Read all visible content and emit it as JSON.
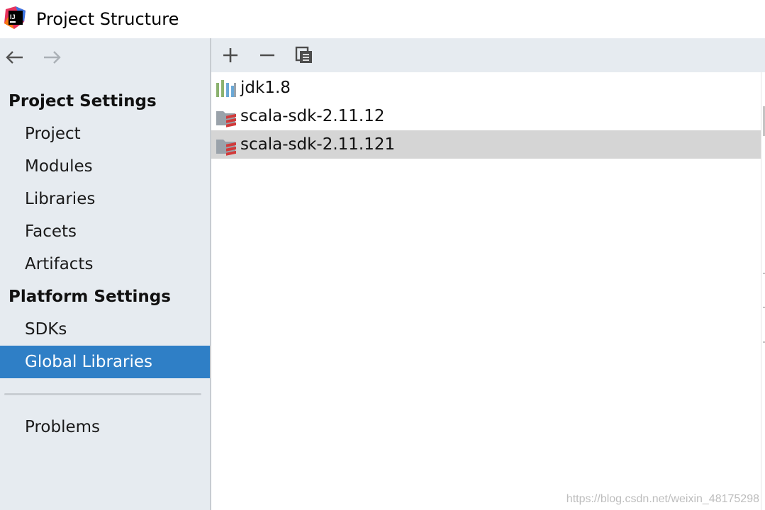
{
  "window": {
    "title": "Project Structure",
    "app_icon": "intellij-idea-icon"
  },
  "sidebar": {
    "back_icon": "arrow-left-icon",
    "forward_icon": "arrow-right-icon",
    "project_settings": {
      "header": "Project Settings",
      "items": [
        {
          "label": "Project"
        },
        {
          "label": "Modules"
        },
        {
          "label": "Libraries"
        },
        {
          "label": "Facets"
        },
        {
          "label": "Artifacts"
        }
      ]
    },
    "platform_settings": {
      "header": "Platform Settings",
      "items": [
        {
          "label": "SDKs"
        },
        {
          "label": "Global Libraries",
          "selected": true
        }
      ]
    },
    "problems": {
      "label": "Problems"
    }
  },
  "toolbar": {
    "add_icon": "plus-icon",
    "remove_icon": "minus-icon",
    "copy_icon": "copy-icon"
  },
  "libraries": [
    {
      "label": "jdk1.8",
      "icon": "jdk-library-icon",
      "selected": false
    },
    {
      "label": "scala-sdk-2.11.12",
      "icon": "scala-library-icon",
      "selected": false
    },
    {
      "label": "scala-sdk-2.11.121",
      "icon": "scala-library-icon",
      "selected": true
    }
  ],
  "watermark": "https://blog.csdn.net/weixin_48175298",
  "colors": {
    "sidebar_bg": "#e6ebf0",
    "selection_blue": "#2f7fc6",
    "row_selection_gray": "#d5d5d5"
  }
}
